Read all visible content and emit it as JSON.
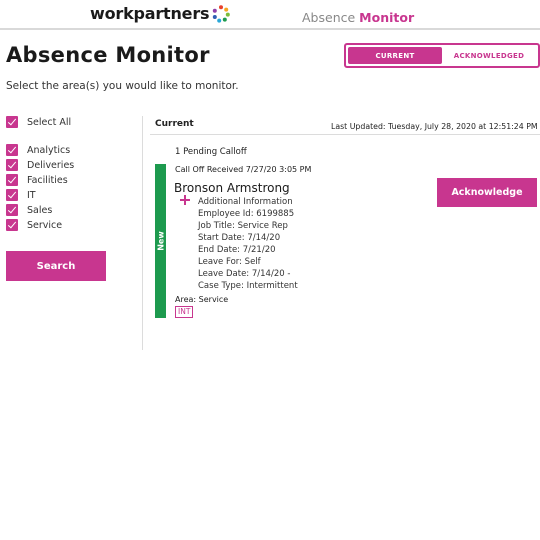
{
  "header": {
    "logo_text": "workpartners",
    "app_title_prefix": "Absence",
    "app_title_accent": "Monitor"
  },
  "page": {
    "title": "Absence Monitor",
    "subtitle": "Select the area(s) you would like to monitor."
  },
  "toggle": {
    "current_label": "CURRENT",
    "acknowledged_label": "ACKNOWLEDGED",
    "selected": "CURRENT"
  },
  "sidebar": {
    "select_all": {
      "label": "Select All",
      "checked": true
    },
    "areas": [
      {
        "label": "Analytics",
        "checked": true
      },
      {
        "label": "Deliveries",
        "checked": true
      },
      {
        "label": "Facilities",
        "checked": true
      },
      {
        "label": "IT",
        "checked": true
      },
      {
        "label": "Sales",
        "checked": true
      },
      {
        "label": "Service",
        "checked": true
      }
    ],
    "search_label": "Search"
  },
  "main": {
    "section_title": "Current",
    "last_updated": "Last Updated: Tuesday, July 28, 2020 at 12:51:24 PM",
    "pending_count": "1 Pending Calloff",
    "card": {
      "status_label": "New",
      "received": "Call Off Received 7/27/20 3:05 PM",
      "name": "Bronson Armstrong",
      "details": [
        "Additional Information",
        "Employee Id: 6199885",
        "Job Title: Service Rep",
        "Start Date: 7/14/20",
        "End Date: 7/21/20",
        "Leave For: Self",
        "Leave Date: 7/14/20 -",
        "Case Type: Intermittent"
      ],
      "area": "Area: Service",
      "tag": "INT",
      "acknowledge_label": "Acknowledge"
    }
  },
  "colors": {
    "accent": "#c8368f",
    "status_new": "#1d9a4e"
  }
}
